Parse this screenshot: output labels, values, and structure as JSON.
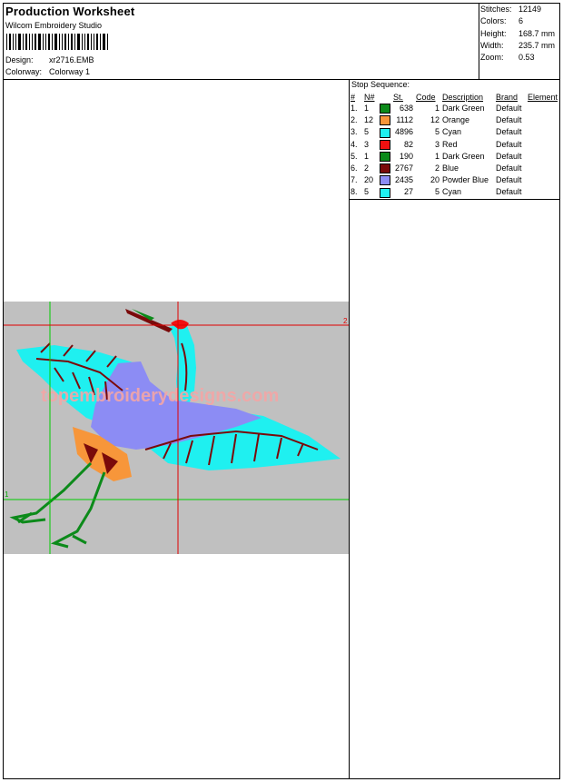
{
  "header": {
    "title": "Production Worksheet",
    "software": "Wilcom Embroidery Studio",
    "design_label": "Design:",
    "design_value": "xr2716.EMB",
    "colorway_label": "Colorway:",
    "colorway_value": "Colorway 1"
  },
  "stats": [
    {
      "label": "Stitches:",
      "value": "12149"
    },
    {
      "label": "Colors:",
      "value": "6"
    },
    {
      "label": "Height:",
      "value": "168.7 mm"
    },
    {
      "label": "Width:",
      "value": "235.7 mm"
    },
    {
      "label": "Zoom:",
      "value": "0.53"
    }
  ],
  "stop_sequence": {
    "title": "Stop Sequence:",
    "headers": [
      "#",
      "N#",
      "St.",
      "Code",
      "Description",
      "Brand",
      "Element"
    ],
    "rows": [
      {
        "idx": "1.",
        "n": "1",
        "color": "#0c8a1a",
        "st": "638",
        "code": "1",
        "desc": "Dark Green",
        "brand": "Default"
      },
      {
        "idx": "2.",
        "n": "12",
        "color": "#f7963a",
        "st": "1112",
        "code": "12",
        "desc": "Orange",
        "brand": "Default"
      },
      {
        "idx": "3.",
        "n": "5",
        "color": "#1ff0f0",
        "st": "4896",
        "code": "5",
        "desc": "Cyan",
        "brand": "Default"
      },
      {
        "idx": "4.",
        "n": "3",
        "color": "#f01010",
        "st": "82",
        "code": "3",
        "desc": "Red",
        "brand": "Default"
      },
      {
        "idx": "5.",
        "n": "1",
        "color": "#0c8a1a",
        "st": "190",
        "code": "1",
        "desc": "Dark Green",
        "brand": "Default"
      },
      {
        "idx": "6.",
        "n": "2",
        "color": "#7a0a0a",
        "st": "2767",
        "code": "2",
        "desc": "Blue",
        "brand": "Default"
      },
      {
        "idx": "7.",
        "n": "20",
        "color": "#8c8cf4",
        "st": "2435",
        "code": "20",
        "desc": "Powder Blue",
        "brand": "Default"
      },
      {
        "idx": "8.",
        "n": "5",
        "color": "#1ff0f0",
        "st": "27",
        "code": "5",
        "desc": "Cyan",
        "brand": "Default"
      }
    ]
  },
  "design_area": {
    "watermark": "topembroiderydesigns.com",
    "marker_start": "1",
    "marker_end": "2"
  }
}
